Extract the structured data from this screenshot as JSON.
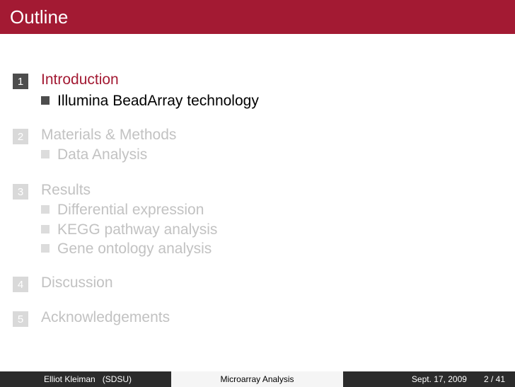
{
  "slide": {
    "title": "Outline"
  },
  "sections": [
    {
      "number": "1",
      "title": "Introduction",
      "state": "active",
      "subsections": [
        "Illumina BeadArray technology"
      ]
    },
    {
      "number": "2",
      "title": "Materials & Methods",
      "state": "dimmed",
      "subsections": [
        "Data Analysis"
      ]
    },
    {
      "number": "3",
      "title": "Results",
      "state": "dimmed",
      "subsections": [
        "Differential expression",
        "KEGG pathway analysis",
        "Gene ontology analysis"
      ]
    },
    {
      "number": "4",
      "title": "Discussion",
      "state": "dimmed",
      "subsections": []
    },
    {
      "number": "5",
      "title": "Acknowledgements",
      "state": "dimmed",
      "subsections": []
    }
  ],
  "footer": {
    "author": "Elliot Kleiman",
    "institute": "(SDSU)",
    "presentation_title": "Microarray Analysis",
    "date": "Sept. 17, 2009",
    "page": "2 / 41"
  },
  "colors": {
    "accent": "#a31a33",
    "active_number": "#4d4d4d",
    "dimmed_text": "#c2c2c2"
  }
}
